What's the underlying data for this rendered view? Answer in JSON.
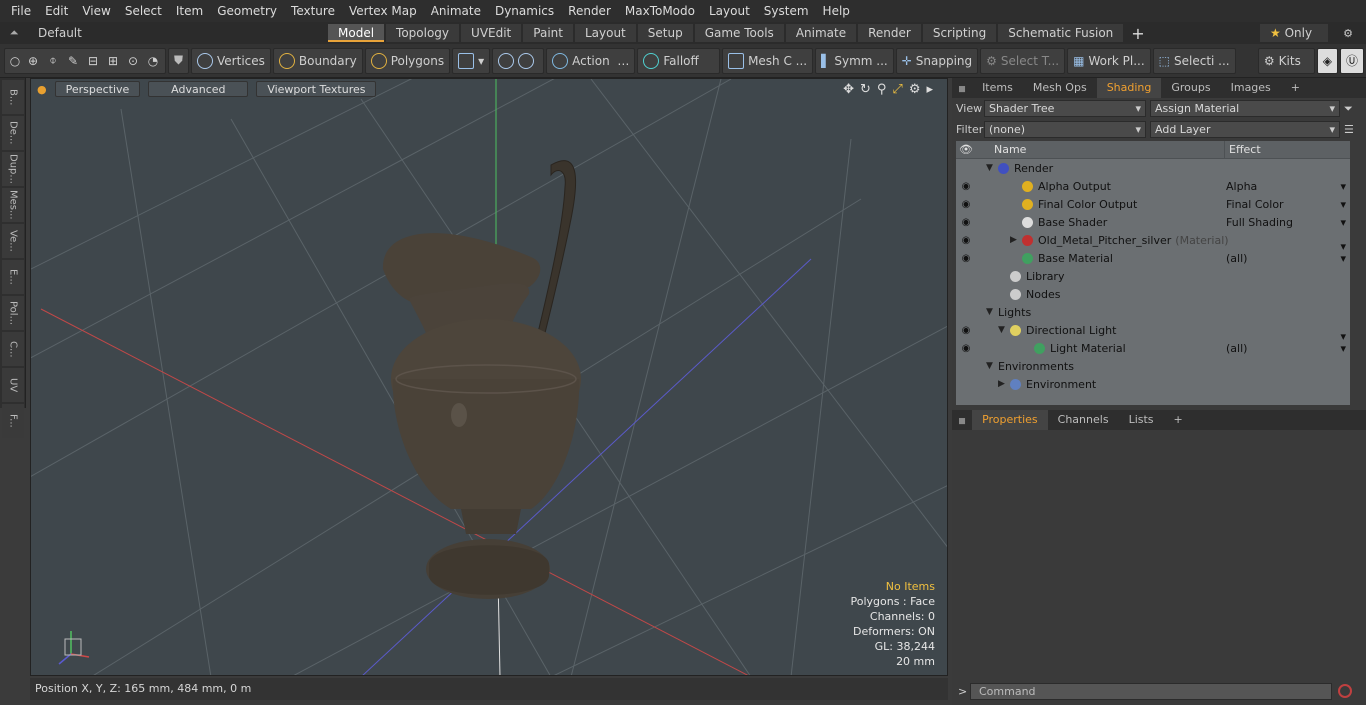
{
  "menu": [
    "File",
    "Edit",
    "View",
    "Select",
    "Item",
    "Geometry",
    "Texture",
    "Vertex Map",
    "Animate",
    "Dynamics",
    "Render",
    "MaxToModo",
    "Layout",
    "System",
    "Help"
  ],
  "layout_selector": "Default Layouts",
  "mode_tabs": [
    "Model",
    "Topology",
    "UVEdit",
    "Paint",
    "Layout",
    "Setup",
    "Game Tools",
    "Animate",
    "Render",
    "Scripting",
    "Schematic Fusion"
  ],
  "active_tab": "Model",
  "only_label": "Only",
  "toolbar": {
    "vertices": "Vertices",
    "boundary": "Boundary",
    "polygons": "Polygons",
    "action": "Action",
    "falloff": "Falloff",
    "meshc": "Mesh C ...",
    "symm": "Symm ...",
    "snapping": "Snapping",
    "selectt": "Select T...",
    "workpl": "Work Pl...",
    "selecti": "Selecti ...",
    "kits": "Kits"
  },
  "left_strip": [
    "B...",
    "De...",
    "Dup...",
    "Mes...",
    "Ve...",
    "E...",
    "Pol...",
    "C...",
    "UV",
    "F..."
  ],
  "viewport": {
    "view_mode": "Perspective",
    "advanced": "Advanced",
    "textures": "Viewport Textures",
    "info": {
      "items": "No Items",
      "polygons": "Polygons : Face",
      "channels": "Channels: 0",
      "deformers": "Deformers: ON",
      "gl": "GL: 38,244",
      "scale": "20 mm"
    }
  },
  "status": "Position X, Y, Z:   165 mm, 484 mm, 0 m",
  "right_tabs": [
    "Items",
    "Mesh Ops",
    "Shading",
    "Groups",
    "Images"
  ],
  "active_right_tab": "Shading",
  "shading": {
    "view_label": "View",
    "view_value": "Shader Tree",
    "assign": "Assign Material",
    "filter_label": "Filter",
    "filter_value": "(none)",
    "add_layer": "Add Layer",
    "col_name": "Name",
    "col_effect": "Effect",
    "rows": [
      {
        "name": "Render",
        "effect": "",
        "eye": false,
        "indent": 0,
        "color": "#4050c0",
        "tri": "▼",
        "sub": ""
      },
      {
        "name": "Alpha Output",
        "effect": "Alpha",
        "eye": true,
        "indent": 2,
        "color": "#e0b020",
        "tri": "",
        "sub": ""
      },
      {
        "name": "Final Color Output",
        "effect": "Final Color",
        "eye": true,
        "indent": 2,
        "color": "#e0b020",
        "tri": "",
        "sub": ""
      },
      {
        "name": "Base Shader",
        "effect": "Full Shading",
        "eye": true,
        "indent": 2,
        "color": "#dddddd",
        "tri": "",
        "sub": ""
      },
      {
        "name": "Old_Metal_Pitcher_silver",
        "effect": "",
        "eye": true,
        "indent": 2,
        "color": "#c03030",
        "tri": "▶",
        "sub": "(Material)"
      },
      {
        "name": "Base Material",
        "effect": "(all)",
        "eye": true,
        "indent": 2,
        "color": "#40a060",
        "tri": "",
        "sub": ""
      },
      {
        "name": "Library",
        "effect": "",
        "eye": false,
        "indent": 1,
        "color": "#cccccc",
        "tri": "",
        "sub": ""
      },
      {
        "name": "Nodes",
        "effect": "",
        "eye": false,
        "indent": 1,
        "color": "#cccccc",
        "tri": "",
        "sub": ""
      },
      {
        "name": "Lights",
        "effect": "",
        "eye": false,
        "indent": 0,
        "color": "",
        "tri": "▼",
        "sub": ""
      },
      {
        "name": "Directional Light",
        "effect": "",
        "eye": true,
        "indent": 1,
        "color": "#e0d060",
        "tri": "▼",
        "sub": ""
      },
      {
        "name": "Light Material",
        "effect": "(all)",
        "eye": true,
        "indent": 3,
        "color": "#40a060",
        "tri": "",
        "sub": ""
      },
      {
        "name": "Environments",
        "effect": "",
        "eye": false,
        "indent": 0,
        "color": "",
        "tri": "▼",
        "sub": ""
      },
      {
        "name": "Environment",
        "effect": "",
        "eye": false,
        "indent": 1,
        "color": "#6080c0",
        "tri": "▶",
        "sub": ""
      }
    ]
  },
  "prop_tabs": [
    "Properties",
    "Channels",
    "Lists"
  ],
  "active_prop_tab": "Properties",
  "command_placeholder": "Command"
}
